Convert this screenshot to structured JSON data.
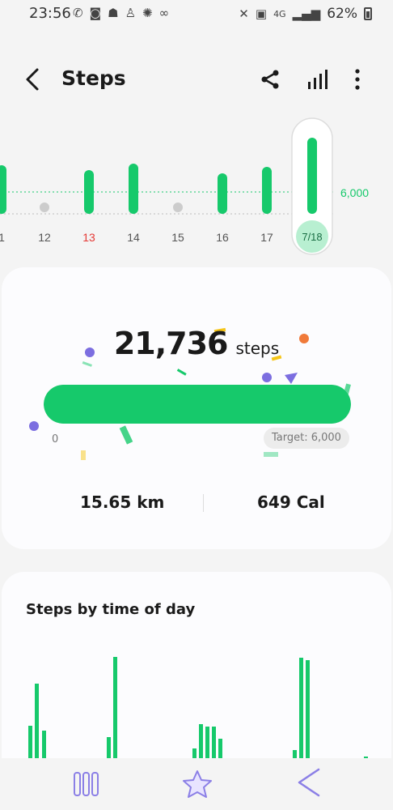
{
  "status_bar": {
    "time": "23:56",
    "left_icons": [
      "whatsapp-icon",
      "discord-icon",
      "ghost-icon",
      "person-icon",
      "aperture-icon",
      "glasses-icon"
    ],
    "network": "4G",
    "battery_percent": "62%"
  },
  "header": {
    "title": "Steps",
    "icons": [
      "back-icon",
      "share-icon",
      "bar-chart-icon",
      "more-icon"
    ]
  },
  "weekly_chart": {
    "target_label": "6,000",
    "days": [
      {
        "label": "1",
        "has_steps": true
      },
      {
        "label": "12",
        "has_steps": false
      },
      {
        "label": "13",
        "has_steps": true
      },
      {
        "label": "14",
        "has_steps": true
      },
      {
        "label": "15",
        "has_steps": false
      },
      {
        "label": "16",
        "has_steps": true
      },
      {
        "label": "17",
        "has_steps": true
      },
      {
        "label": "7/18",
        "has_steps": true,
        "selected": true
      }
    ],
    "highlight_color": "#e53935",
    "highlight_day": "13"
  },
  "summary": {
    "steps": "21,736",
    "steps_unit": "steps",
    "progress_min": "0",
    "progress_fraction": 1.0,
    "target_label": "Target: 6,000",
    "distance": "15.65 km",
    "calories": "649 Cal"
  },
  "time_of_day": {
    "title": "Steps by time of day"
  },
  "colors": {
    "accent": "#16c96b",
    "background": "#f4f4f4",
    "card": "#fcfcfe"
  },
  "nav": {
    "icons": [
      "recents-icon",
      "home-icon",
      "back-nav-icon"
    ]
  }
}
